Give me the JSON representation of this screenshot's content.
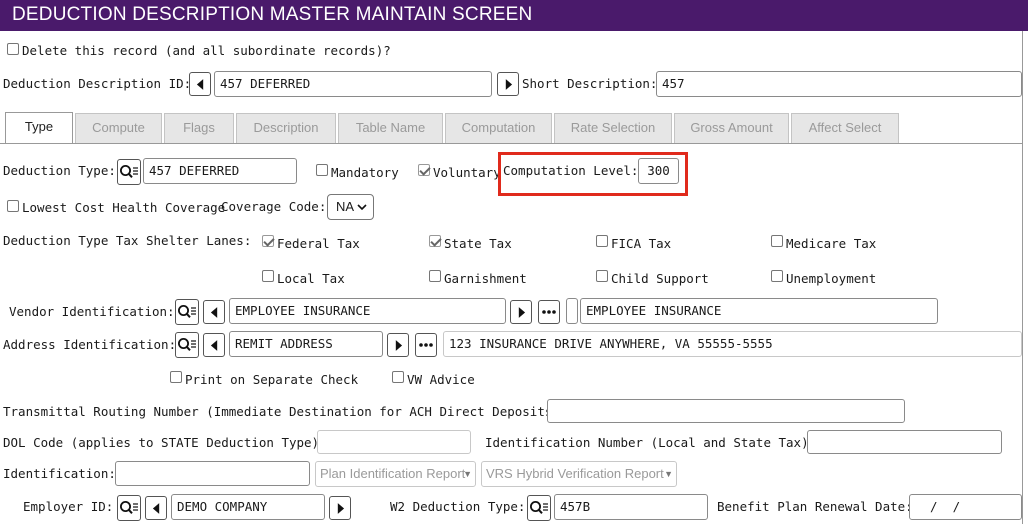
{
  "header": {
    "title": "DEDUCTION DESCRIPTION MASTER MAINTAIN SCREEN"
  },
  "delete_label": "Delete this record (and all subordinate records)?",
  "ident": {
    "id_label": "Deduction Description ID:",
    "id_value": "457 DEFERRED",
    "short_label": "Short Description:",
    "short_value": "457"
  },
  "tabs": [
    {
      "label": "Type"
    },
    {
      "label": "Compute"
    },
    {
      "label": "Flags"
    },
    {
      "label": "Description"
    },
    {
      "label": "Table Name"
    },
    {
      "label": "Computation"
    },
    {
      "label": "Rate Selection"
    },
    {
      "label": "Gross Amount"
    },
    {
      "label": "Affect Select"
    }
  ],
  "type_row": {
    "type_label": "Deduction Type:",
    "type_value": "457 DEFERRED",
    "mandatory_label": "Mandatory",
    "voluntary_label": "Voluntary",
    "comp_level_label": "Computation Level:",
    "comp_level_value": "300"
  },
  "coverage_row": {
    "lowest_label": "Lowest Cost Health Coverage",
    "coverage_label": "Coverage Code:",
    "coverage_value": "NA"
  },
  "shelter": {
    "label": "Deduction Type Tax Shelter Lanes:",
    "federal": "Federal Tax",
    "state": "State Tax",
    "fica": "FICA Tax",
    "medicare": "Medicare Tax",
    "local": "Local Tax",
    "garnish": "Garnishment",
    "child": "Child Support",
    "unemp": "Unemployment"
  },
  "vendor": {
    "label": "Vendor Identification:",
    "value": "EMPLOYEE INSURANCE",
    "name_value": "EMPLOYEE INSURANCE"
  },
  "address": {
    "label": "Address Identification:",
    "value": "REMIT ADDRESS",
    "text_value": "123 INSURANCE DRIVE ANYWHERE, VA  55555-5555"
  },
  "print_label": "Print on Separate Check",
  "vw_label": "VW Advice",
  "transmittal_label": "Transmittal Routing Number (Immediate Destination for ACH Direct Deposits):",
  "dol_label": "DOL Code (applies to STATE Deduction Type):",
  "idnum_label": "Identification Number (Local and State Tax):",
  "identification_label": "Identification:",
  "plan_placeholder": "Plan Identification Report",
  "vrs_placeholder": "VRS Hybrid Verification Report",
  "employer": {
    "label": "Employer ID:",
    "value": "DEMO COMPANY"
  },
  "w2": {
    "label": "W2 Deduction Type:",
    "value": "457B"
  },
  "renewal": {
    "label": "Benefit Plan Renewal Date:",
    "value": "  /  /"
  }
}
